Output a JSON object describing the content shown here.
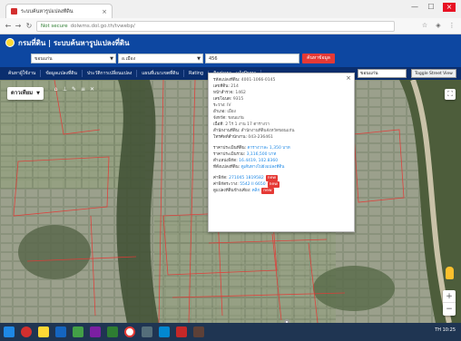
{
  "browser": {
    "tab_title": "ระบบค้นหารูปแปลงที่ดิน",
    "tab_close": "×",
    "url_secure": "Not secure",
    "url": "dolwms.dol.go.th/tvwebp/",
    "win_minimize": "—",
    "win_maximize": "☐",
    "win_close": "×"
  },
  "header": {
    "title": "กรมที่ดิน | ระบบค้นหารูปแปลงที่ดิน"
  },
  "search": {
    "province": "ขอนแก่น",
    "district": "อ.เมือง",
    "parcel_no": "456",
    "button": "ค้นหาข้อมูล"
  },
  "menu": {
    "items": [
      "ค้นหาผู้ใช้งาน",
      "ข้อมูลแปลงที่ดิน",
      "ประวัติการเปลี่ยนแปลง",
      "แผนที่แนวเขตที่ดิน",
      "Rating",
      "ติดต่อเรา - แจ้งปัญหา"
    ],
    "search_value": "ขอนแก่น",
    "toggle_label": "Toggle Street View"
  },
  "map": {
    "type_label": "ดาวเทียม",
    "fullscreen": "⛶",
    "zoom_in": "+",
    "zoom_out": "−"
  },
  "popup": {
    "close": "×",
    "rows": [
      {
        "label": "รหัสแปลงที่ดิน: ",
        "value": "4001-1066-0145"
      },
      {
        "label": "เลขที่ดิน: ",
        "value": "214"
      },
      {
        "label": "หน้าสำรวจ: ",
        "value": "1462"
      },
      {
        "label": "เลขโฉนด: ",
        "value": "9315"
      },
      {
        "label": "ระวาง: ",
        "value": "IV"
      },
      {
        "label": "อำเภอ: ",
        "value": "เมือง"
      },
      {
        "label": "จังหวัด: ",
        "value": "ขอนแก่น"
      },
      {
        "label": "เนื้อที่: ",
        "value": "2 ไร่ 1 งาน 17 ตารางวา"
      },
      {
        "label": "สำนักงานที่ดิน: ",
        "value": "สำนักงานที่ดินจังหวัดขอนแก่น"
      },
      {
        "label": "โทรศัพท์สำนักงาน: ",
        "value": "043-236461"
      }
    ],
    "link_rows": [
      {
        "label": "ราคาประเมินที่ดิน: ",
        "value": "ตารางวาละ 1,350 บาท"
      },
      {
        "label": "ราคาประเมินรวม: ",
        "value": "3,116,500 บาท"
      },
      {
        "label": "ตำแหน่งพิกัด: ",
        "value": "16.4419, 102.8360"
      },
      {
        "label": "ที่ตั้งแปลงที่ดิน: ",
        "value": "ดูเส้นทางไปยังแปลงที่ดิน"
      }
    ],
    "bottom_rows": [
      {
        "label": "ค่าพิกัด: ",
        "value": "271045 1819582",
        "tag": "new"
      },
      {
        "label": "ค่าพิกัดระวาง: ",
        "value": "5542 II 6650",
        "tag": "new"
      },
      {
        "label": "ดูแปลงที่ดินข้างเคียง: ",
        "value": "คลิก",
        "tag": "new"
      }
    ]
  },
  "taskbar": {
    "tray_text": "TH 10:25"
  }
}
